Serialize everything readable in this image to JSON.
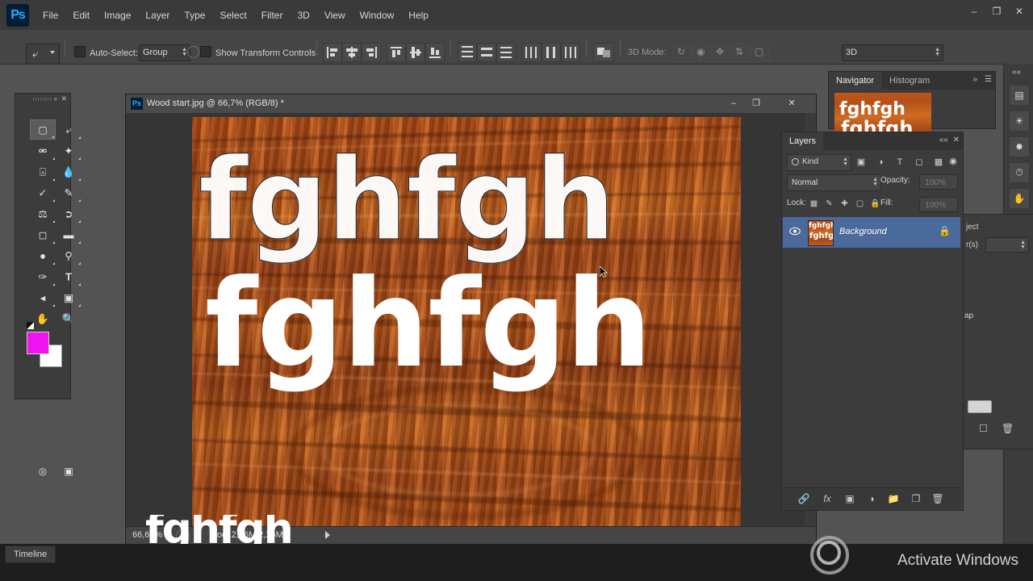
{
  "app": {
    "name": "Ps",
    "title": "Adobe Photoshop"
  },
  "menubar": {
    "items": [
      "File",
      "Edit",
      "Image",
      "Layer",
      "Type",
      "Select",
      "Filter",
      "3D",
      "View",
      "Window",
      "Help"
    ],
    "window_controls": [
      "–",
      "❐",
      "✕"
    ]
  },
  "options_bar": {
    "tool_icon": "move-tool",
    "auto_select_label": "Auto-Select:",
    "auto_select_value": "Group",
    "show_transform_label": "Show Transform Controls",
    "mode_3d_label": "3D Mode:",
    "workspace_value": "3D",
    "align_icons": [
      "align-left-edges",
      "align-horizontal-centers",
      "align-right-edges",
      "align-top-edges",
      "align-vertical-centers",
      "align-bottom-edges",
      "distribute-top",
      "distribute-vertical-center",
      "distribute-bottom",
      "distribute-left",
      "distribute-horizontal-center",
      "distribute-right",
      "auto-align"
    ],
    "mode_3d_icons": [
      "rotate-3d",
      "roll-3d",
      "drag-3d",
      "slide-3d",
      "scale-3d"
    ]
  },
  "toolbox": {
    "title": "tools-panel",
    "tools": [
      "rectangular-marquee-tool",
      "move-tool",
      "lasso-tool",
      "quick-selection-tool",
      "crop-tool",
      "eyedropper-tool",
      "spot-healing-brush-tool",
      "brush-tool",
      "clone-stamp-tool",
      "history-brush-tool",
      "eraser-tool",
      "gradient-tool",
      "blur-tool",
      "dodge-tool",
      "pen-tool",
      "horizontal-type-tool",
      "path-selection-tool",
      "rectangle-tool",
      "hand-tool",
      "zoom-tool"
    ],
    "foreground_color": "#ef13ef",
    "background_color": "#ffffff",
    "quick_mask_icon": "edit-in-quick-mask-mode",
    "screen_mode_icon": "change-screen-mode"
  },
  "document": {
    "app_icon": "ps-document-icon",
    "title": "Wood start.jpg @ 66,7% (RGB/8) *",
    "window_controls": [
      "–",
      "❐",
      "✕"
    ],
    "status": {
      "zoom": "66,67%",
      "doc_label": "Doc: 2,26M/2,26M"
    },
    "canvas_text": {
      "marquee_word": "fghfgh",
      "white_word": "fghfgh"
    }
  },
  "navigator": {
    "tabs": [
      "Navigator",
      "Histogram"
    ],
    "collapse_icon": "collapse-to-icons",
    "menu_icon": "panel-menu"
  },
  "layers": {
    "tabs": [
      "Layers"
    ],
    "collapse_icon": "collapse-to-icons",
    "close_icon": "close-panel",
    "filter_label": "Kind",
    "filter_icons": [
      "filter-pixel",
      "filter-adjustment",
      "filter-type",
      "filter-shape",
      "filter-smart-object"
    ],
    "blend_mode": "Normal",
    "opacity_label": "Opacity:",
    "opacity_value": "100%",
    "lock_label": "Lock:",
    "lock_icons": [
      "lock-transparent-pixels",
      "lock-image-pixels",
      "lock-position",
      "lock-artboard",
      "lock-all"
    ],
    "fill_label": "Fill:",
    "fill_value": "100%",
    "rows": [
      {
        "name": "Background",
        "visible_icon": "eye-icon",
        "lock_icon": "lock-icon"
      }
    ],
    "bottom_icons": [
      "link-layers",
      "add-layer-style",
      "add-layer-mask",
      "new-fill-adjustment-layer",
      "new-group",
      "new-layer",
      "delete-layer"
    ]
  },
  "right_rail": {
    "icons": [
      "expand-dock",
      "color-panel-icon",
      "adjustments-panel-icon",
      "styles-panel-icon",
      "history-panel-icon",
      "properties-panel-icon",
      "channels-panel-icon",
      "paths-panel-icon"
    ]
  },
  "right_stack": {
    "tab_label": "ject",
    "field_label": "r(s)",
    "map_label": "ap",
    "bottom_icons": [
      "new-item",
      "delete-item"
    ]
  },
  "timeline": {
    "tab_label": "Timeline"
  },
  "watermark": {
    "text": "Activate Windows"
  },
  "colors": {
    "accent_blue": "#31a8ff",
    "panel_bg": "#3c3c3c",
    "selected_layer": "#4b6a9c",
    "foreground": "#ef13ef"
  }
}
